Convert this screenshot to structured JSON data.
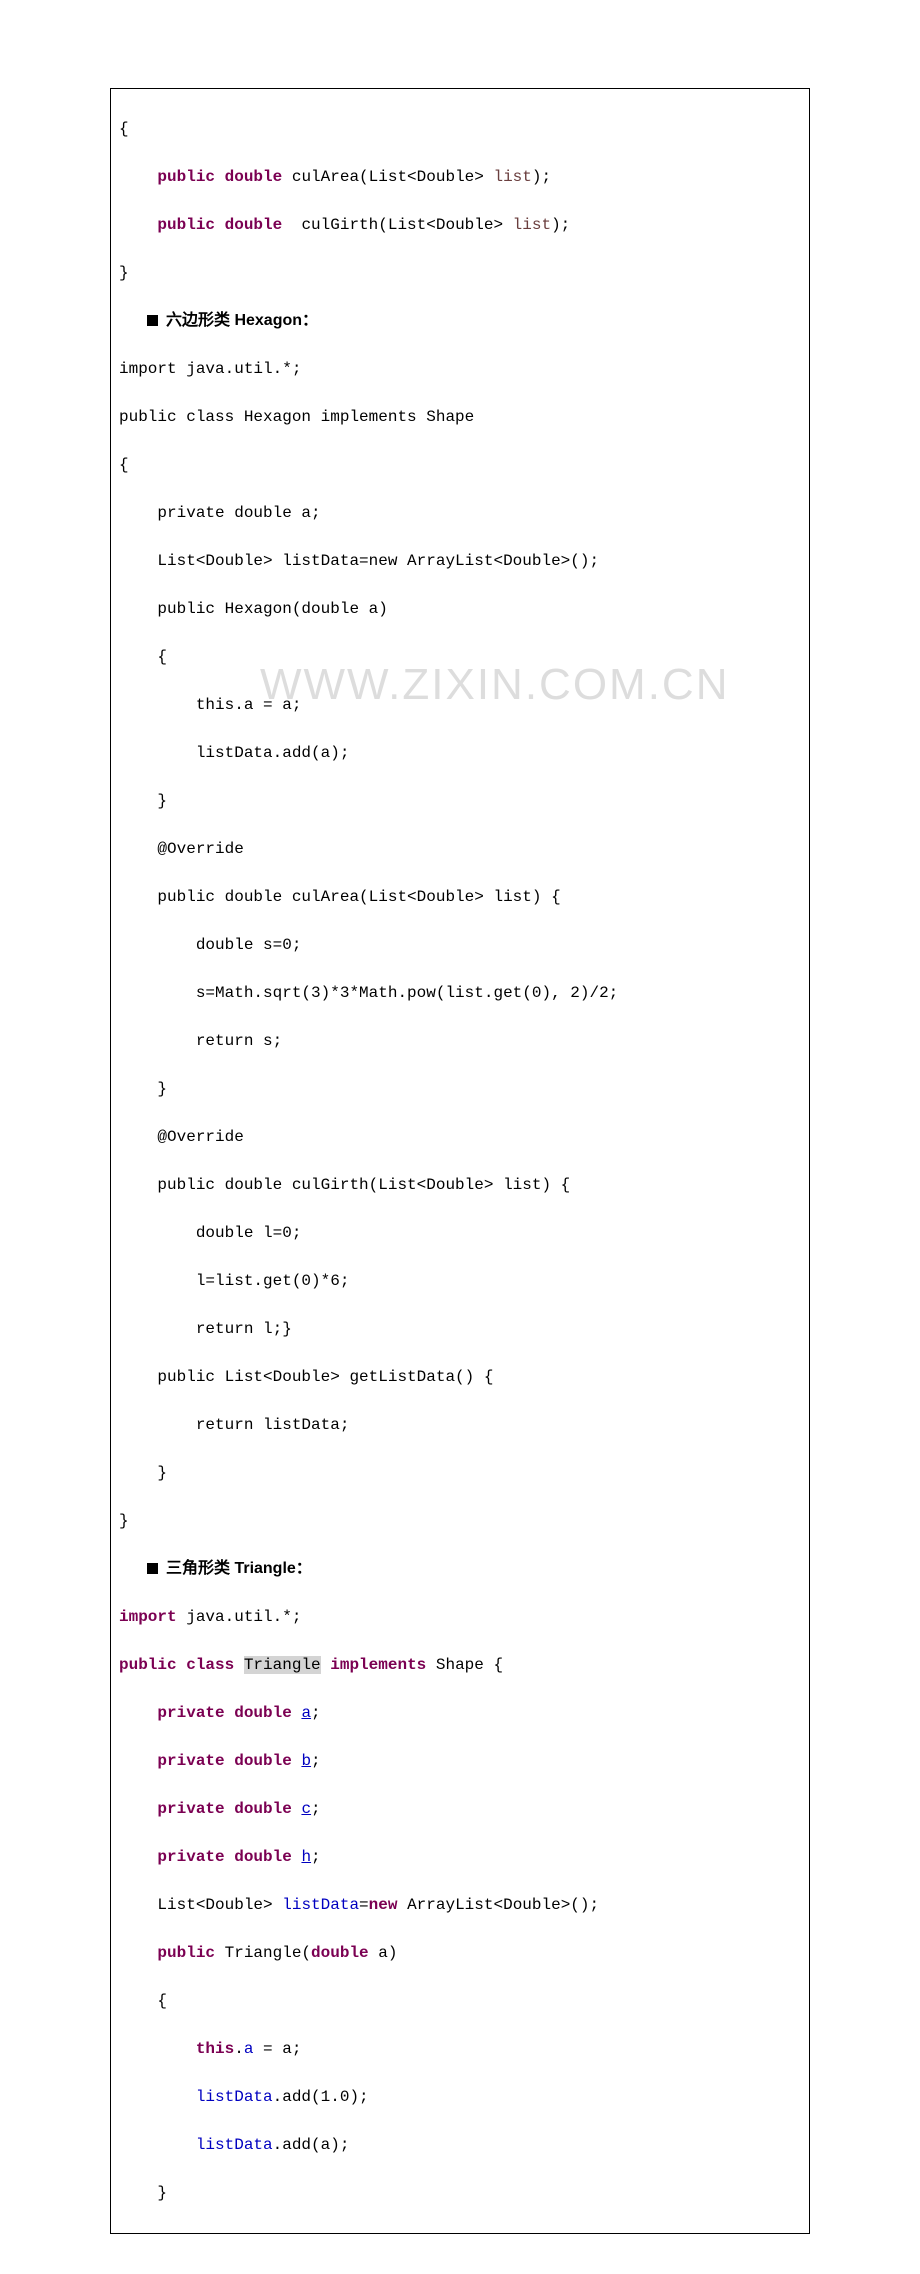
{
  "code": {
    "l1": "{",
    "l2a": "    ",
    "l2b": "public double",
    "l2c": " culArea(List<Double> ",
    "l2d": "list",
    "l2e": ");",
    "l3a": "    ",
    "l3b": "public double",
    "l3c": "  culGirth(List<Double> ",
    "l3d": "list",
    "l3e": ");",
    "l4": "}",
    "h1b": "六边形类 Hexagon：",
    "l5": "import java.util.*;",
    "l6": "public class Hexagon implements Shape",
    "l7": "{",
    "l8": "    private double a;",
    "l9": "    List<Double> listData=new ArrayList<Double>();",
    "l10": "    public Hexagon(double a)",
    "l11": "    {",
    "l12": "        this.a = a;",
    "l13": "        listData.add(a);",
    "l14": "    }",
    "l15": "    @Override",
    "l16": "    public double culArea(List<Double> list) {",
    "l17": "        double s=0;",
    "l18": "        s=Math.sqrt(3)*3*Math.pow(list.get(0), 2)/2;",
    "l19": "        return s;",
    "l20": "    }",
    "l21": "    @Override",
    "l22": "    public double culGirth(List<Double> list) {",
    "l23": "        double l=0;",
    "l24": "        l=list.get(0)*6;",
    "l25": "        return l;}",
    "l26": "    public List<Double> getListData() {",
    "l27": "        return listData;",
    "l28": "    }",
    "l29": "}",
    "h2b": "三角形类 Triangle：",
    "l30a": "import",
    "l30b": " java.util.*;",
    "l31a": "public class ",
    "l31b": "Triangle",
    "l31c": " ",
    "l31d": "implements",
    "l31e": " Shape {",
    "l32a": "    ",
    "l32b": "private double ",
    "l32c": "a",
    "l32d": ";",
    "l33a": "    ",
    "l33b": "private double ",
    "l33c": "b",
    "l33d": ";",
    "l34a": "    ",
    "l34b": "private double ",
    "l34c": "c",
    "l34d": ";",
    "l35a": "    ",
    "l35b": "private double ",
    "l35c": "h",
    "l35d": ";",
    "l36a": "    List<Double> ",
    "l36b": "listData",
    "l36c": "=",
    "l36d": "new",
    "l36e": " ArrayList<Double>();",
    "l37a": "    ",
    "l37b": "public",
    "l37c": " Triangle(",
    "l37d": "double",
    "l37e": " a)",
    "l38": "    {",
    "l39a": "        ",
    "l39b": "this",
    "l39c": ".",
    "l39d": "a",
    "l39e": " = a;",
    "l40a": "        ",
    "l40b": "listData",
    "l40c": ".add(1.0);",
    "l41a": "        ",
    "l41b": "listData",
    "l41c": ".add(a);",
    "l42": "    }"
  },
  "watermark": "WWW.ZIXIN.COM.CN"
}
